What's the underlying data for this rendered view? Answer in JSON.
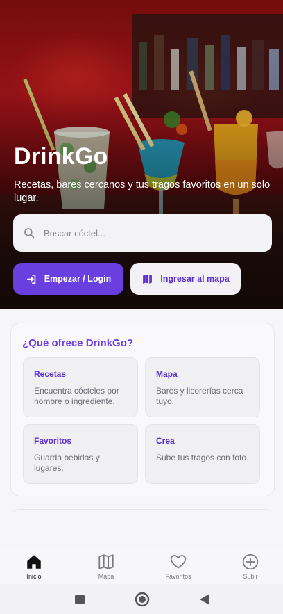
{
  "hero": {
    "app_name": "DrinkGo",
    "tagline": "Recetas, bares cercanos y tus tragos favoritos en un solo lugar."
  },
  "search": {
    "placeholder": "Buscar cóctel...",
    "value": ""
  },
  "actions": {
    "primary_label": "Empezar / Login",
    "secondary_label": "Ingresar al mapa"
  },
  "offer": {
    "title": "¿Qué ofrece DrinkGo?",
    "features": [
      {
        "title": "Recetas",
        "description": "Encuentra cócteles por nombre o ingrediente."
      },
      {
        "title": "Mapa",
        "description": "Bares y licorerías cerca tuyo."
      },
      {
        "title": "Favoritos",
        "description": "Guarda bebidas y lugares."
      },
      {
        "title": "Crea",
        "description": "Sube tus tragos con foto."
      }
    ]
  },
  "tabbar": {
    "tabs": [
      {
        "label": "Inicio",
        "icon": "home-icon",
        "active": true
      },
      {
        "label": "Mapa",
        "icon": "map-icon",
        "active": false
      },
      {
        "label": "Favoritos",
        "icon": "heart-icon",
        "active": false
      },
      {
        "label": "Subir",
        "icon": "plus-circle-icon",
        "active": false
      }
    ]
  },
  "colors": {
    "accent": "#6a3fe0",
    "accent_text": "#5a2fcf"
  }
}
